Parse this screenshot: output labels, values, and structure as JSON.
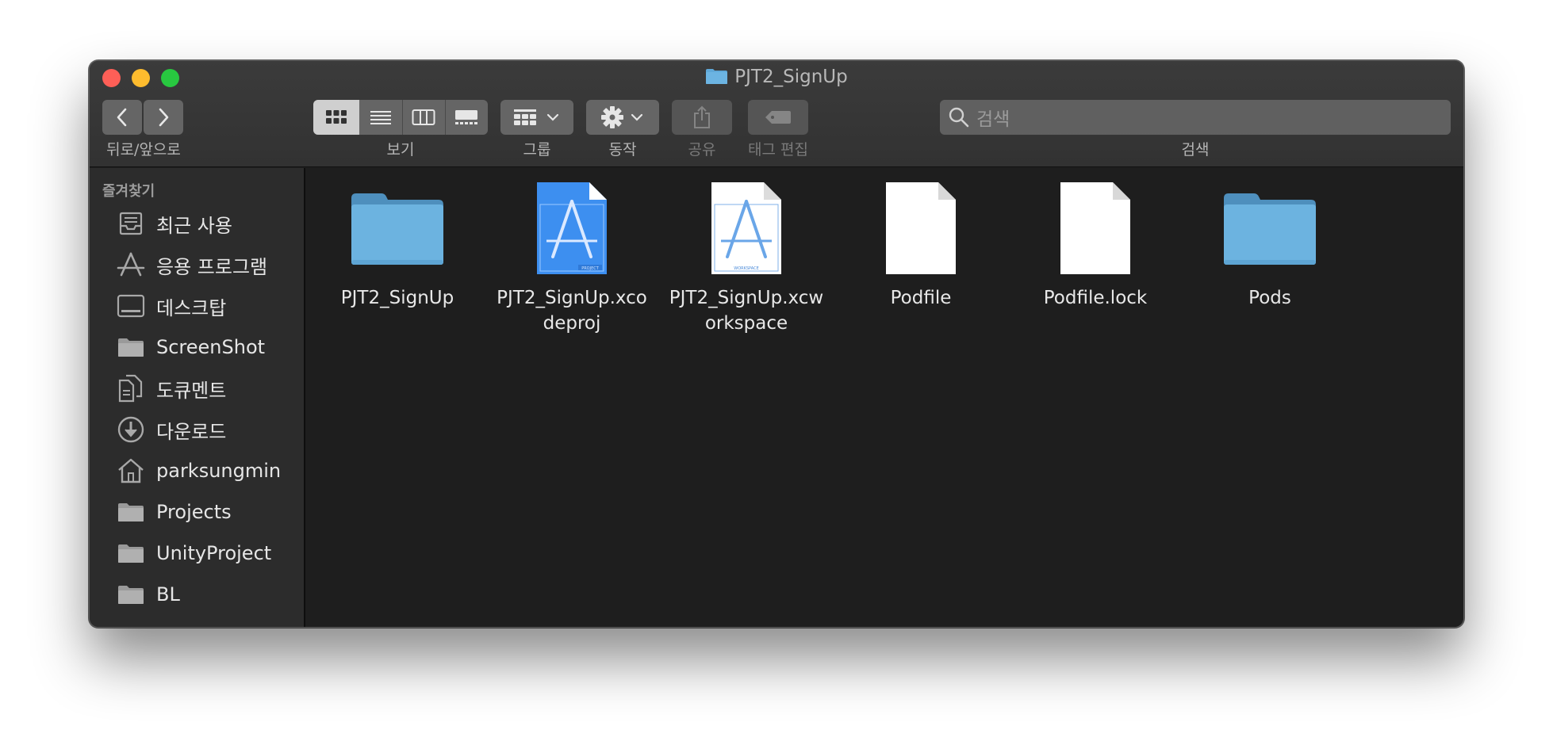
{
  "window": {
    "title": "PJT2_SignUp"
  },
  "toolbar": {
    "nav_label": "뒤로/앞으로",
    "view_label": "보기",
    "group_label": "그룹",
    "action_label": "동작",
    "share_label": "공유",
    "tag_label": "태그 편집",
    "search_label": "검색",
    "search_placeholder": "검색"
  },
  "sidebar": {
    "header": "즐겨찾기",
    "items": [
      {
        "label": "최근 사용",
        "icon": "recents-icon"
      },
      {
        "label": "응용 프로그램",
        "icon": "applications-icon"
      },
      {
        "label": "데스크탑",
        "icon": "desktop-icon"
      },
      {
        "label": "ScreenShot",
        "icon": "folder-icon"
      },
      {
        "label": "도큐멘트",
        "icon": "documents-icon"
      },
      {
        "label": "다운로드",
        "icon": "downloads-icon"
      },
      {
        "label": "parksungmin",
        "icon": "home-icon"
      },
      {
        "label": "Projects",
        "icon": "folder-icon"
      },
      {
        "label": "UnityProject",
        "icon": "folder-icon"
      },
      {
        "label": "BL",
        "icon": "folder-icon"
      }
    ]
  },
  "files": [
    {
      "name": "PJT2_SignUp",
      "icon": "folder-icon"
    },
    {
      "name": "PJT2_SignUp.xcodeproj",
      "icon": "xcodeproj-icon",
      "badge": "PROJECT"
    },
    {
      "name": "PJT2_SignUp.xcworkspace",
      "icon": "xcworkspace-icon",
      "badge": "WORKSPACE"
    },
    {
      "name": "Podfile",
      "icon": "document-icon"
    },
    {
      "name": "Podfile.lock",
      "icon": "document-icon"
    },
    {
      "name": "Pods",
      "icon": "folder-icon"
    }
  ],
  "colors": {
    "folder": "#5fa8d8",
    "close": "#fe5f57",
    "minimize": "#febc2e",
    "maximize": "#28c840"
  }
}
